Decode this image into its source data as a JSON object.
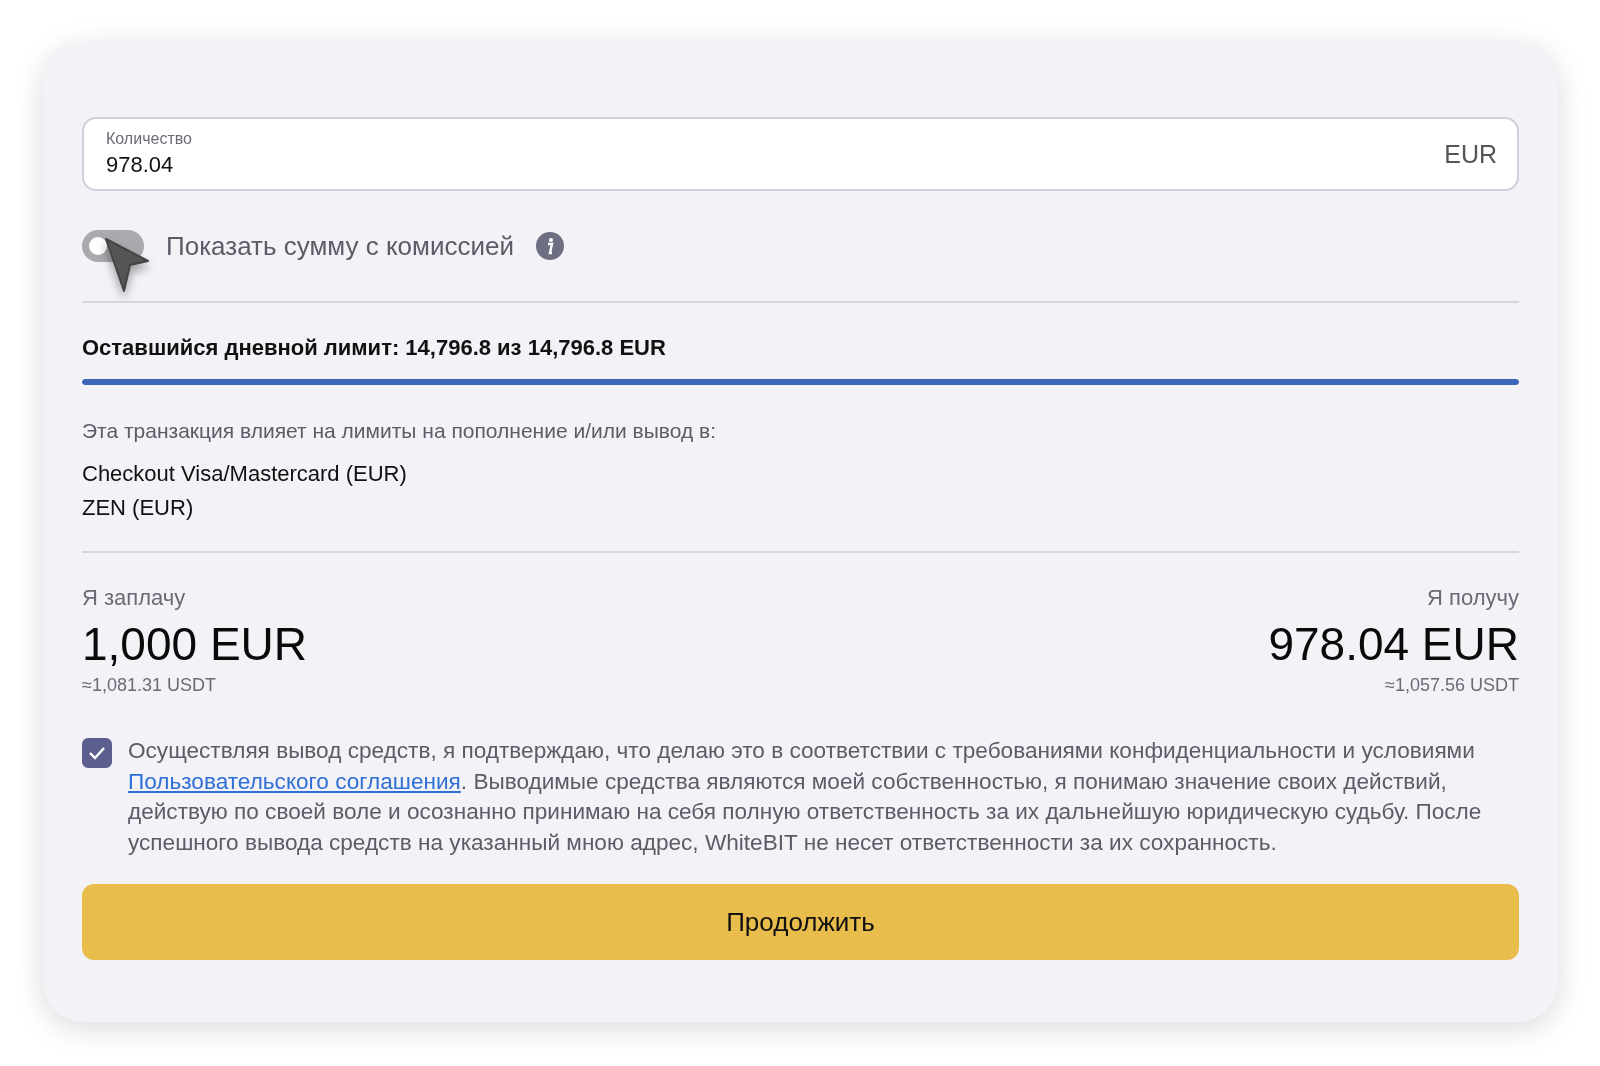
{
  "amount_field": {
    "label": "Количество",
    "value": "978.04",
    "currency": "EUR"
  },
  "fee_toggle": {
    "label": "Показать сумму с комиссией",
    "on": false
  },
  "daily_limit": {
    "text": "Оставшийся дневной лимит: 14,796.8 из 14,796.8 EUR",
    "level": 1
  },
  "limits_note": {
    "text": "Эта транзакция влияет на лимиты на пополнение и/или вывод в:",
    "methods": [
      "Checkout Visa/Mastercard (EUR)",
      "ZEN (EUR)"
    ]
  },
  "pay": {
    "label": "Я заплачу",
    "amount": "1,000 EUR",
    "approx": "≈1,081.31 USDT"
  },
  "receive": {
    "label": "Я получу",
    "amount": "978.04 EUR",
    "approx": "≈1,057.56 USDT"
  },
  "consent": {
    "checked": true,
    "before": "Осуществляя вывод средств, я подтверждаю, что делаю это в соответствии с требованиями конфиденциальности и условиями",
    "link": "Пользовательского соглашения",
    "after": ". Выводимые средства являются моей собственностью, я понимаю значение своих действий, действую по своей воле и осознанно принимаю на себя полную ответственность за их дальнейшую юридическую судьбу. После успешного вывода средств на указанный мною адрес, WhiteBIT не несет ответственности за их сохранность."
  },
  "continue_button": {
    "label": "Продолжить"
  }
}
